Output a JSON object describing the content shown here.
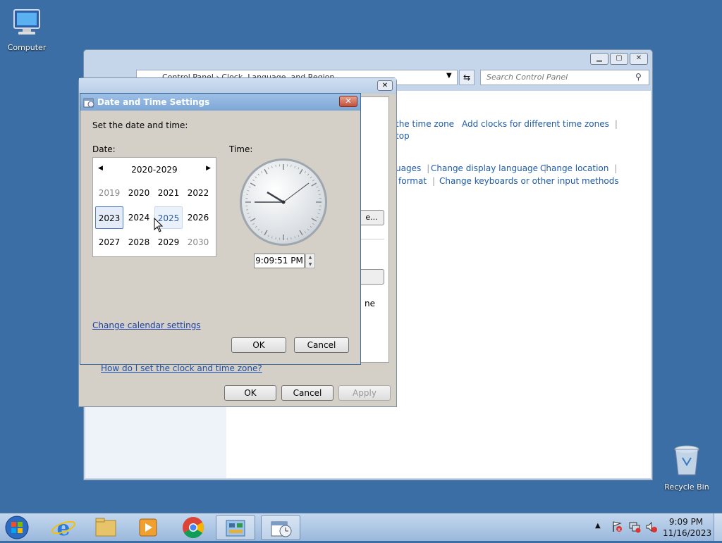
{
  "desktop": {
    "computer_label": "Computer",
    "recycle_label": "Recycle Bin"
  },
  "control_panel": {
    "address": "Control Panel  ›  Clock, Language, and Region",
    "search_placeholder": "Search Control Panel",
    "links": {
      "time_zone": "the time zone",
      "add_clocks": "Add clocks for different time zones",
      "desktop_frag": "top",
      "languages_frag": "uages",
      "change_display_language": "Change display language",
      "change_location": "Change location",
      "format_frag": "format",
      "change_keyboards": "Change keyboards or other input methods"
    }
  },
  "date_time_dialog": {
    "help_link": "How do I set the clock and time zone?",
    "change_btn_frag": "e...",
    "text_frag": "ne",
    "ok": "OK",
    "cancel": "Cancel",
    "apply": "Apply"
  },
  "settings_dialog": {
    "title": "Date and Time Settings",
    "prompt": "Set the date and time:",
    "date_label": "Date:",
    "time_label": "Time:",
    "calendar": {
      "range": "2020-2029",
      "years": [
        "2019",
        "2020",
        "2021",
        "2022",
        "2023",
        "2024",
        "2025",
        "2026",
        "2027",
        "2028",
        "2029",
        "2030"
      ],
      "selected": "2023",
      "hovered": "2025"
    },
    "time_value": "9:09:51 PM",
    "calendar_link": "Change calendar settings",
    "ok": "OK",
    "cancel": "Cancel"
  },
  "taskbar": {
    "time": "9:09 PM",
    "date": "11/16/2023"
  }
}
